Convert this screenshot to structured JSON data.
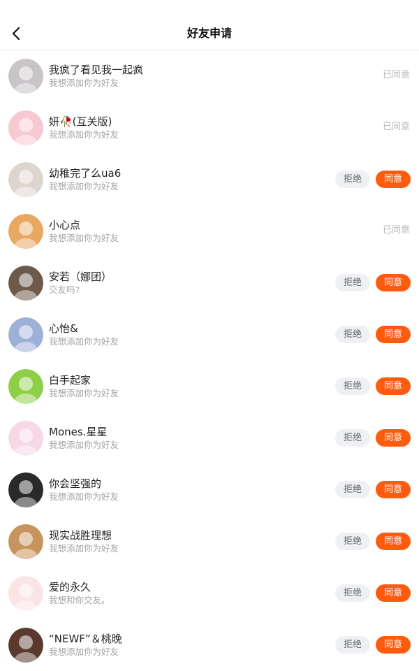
{
  "header": {
    "title": "好友申请",
    "back_icon": "chevron-left-icon"
  },
  "requests": [
    {
      "name": "我疯了看见我一起疯",
      "message": "我想添加你为好友",
      "state": "accepted",
      "status": "已同意",
      "avatar_color": "#c9c4c8"
    },
    {
      "name": "妍🥀(互关版)",
      "message": "我想添加你为好友",
      "state": "accepted",
      "status": "已同意",
      "avatar_color": "#f7c9d2"
    },
    {
      "name": "幼稚完了么ua6",
      "message": "我想添加你为好友",
      "state": "pending",
      "reject": "拒绝",
      "accept": "同意",
      "avatar_color": "#ddd6cf"
    },
    {
      "name": "小心点",
      "message": "我想添加你为好友",
      "state": "accepted",
      "status": "已同意",
      "avatar_color": "#e8a861"
    },
    {
      "name": "安若（娜团）",
      "message": "交友吗?",
      "state": "pending",
      "reject": "拒绝",
      "accept": "同意",
      "avatar_color": "#6e5a4b"
    },
    {
      "name": "心怡&",
      "message": "我想添加你为好友",
      "state": "pending",
      "reject": "拒绝",
      "accept": "同意",
      "avatar_color": "#9fb0d8"
    },
    {
      "name": "白手起家",
      "message": "我想添加你为好友",
      "state": "pending",
      "reject": "拒绝",
      "accept": "同意",
      "avatar_color": "#8fcf48"
    },
    {
      "name": "Mones.星星",
      "message": "我想添加你为好友",
      "state": "pending",
      "reject": "拒绝",
      "accept": "同意",
      "avatar_color": "#f7d8e6"
    },
    {
      "name": "你会坚强的",
      "message": "我想添加你为好友",
      "state": "pending",
      "reject": "拒绝",
      "accept": "同意",
      "avatar_color": "#2a2a2a"
    },
    {
      "name": "现实战胜理想",
      "message": "我想添加你为好友",
      "state": "pending",
      "reject": "拒绝",
      "accept": "同意",
      "avatar_color": "#c8945e"
    },
    {
      "name": "爱的永久",
      "message": "我想和你交友。",
      "state": "pending",
      "reject": "拒绝",
      "accept": "同意",
      "avatar_color": "#fbe4e6"
    },
    {
      "name": "“NEWF”＆桃晚",
      "message": "我想添加你为好友",
      "state": "pending",
      "reject": "拒绝",
      "accept": "同意",
      "avatar_color": "#5a3a2e"
    }
  ]
}
